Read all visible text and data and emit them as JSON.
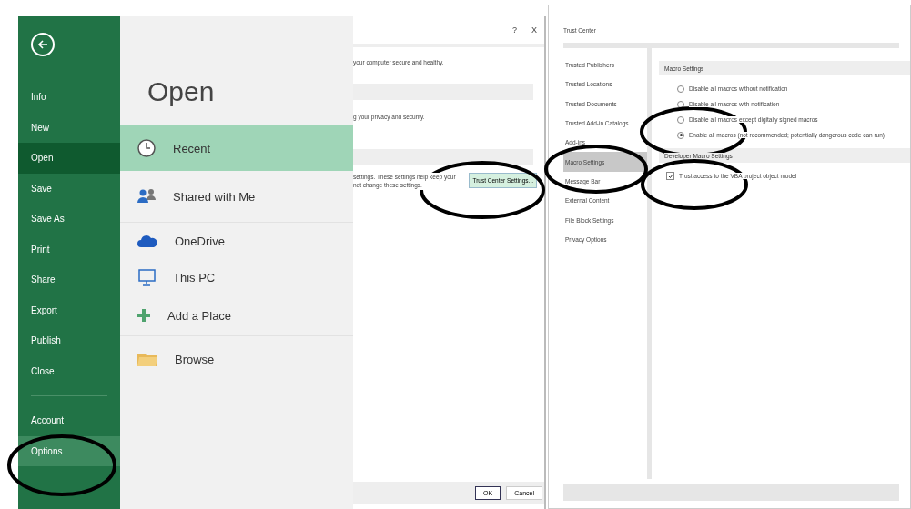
{
  "backstage": {
    "nav": [
      {
        "label": "Info",
        "selected": false,
        "hover": false
      },
      {
        "label": "New",
        "selected": false,
        "hover": false
      },
      {
        "label": "Open",
        "selected": true,
        "hover": false
      },
      {
        "label": "Save",
        "selected": false,
        "hover": false
      },
      {
        "label": "Save As",
        "selected": false,
        "hover": false
      },
      {
        "label": "Print",
        "selected": false,
        "hover": false
      },
      {
        "label": "Share",
        "selected": false,
        "hover": false
      },
      {
        "label": "Export",
        "selected": false,
        "hover": false
      },
      {
        "label": "Publish",
        "selected": false,
        "hover": false
      },
      {
        "label": "Close",
        "selected": false,
        "hover": false
      },
      {
        "label": "Account",
        "selected": false,
        "hover": false
      },
      {
        "label": "Options",
        "selected": false,
        "hover": true
      }
    ],
    "title": "Open",
    "places": [
      {
        "label": "Recent",
        "kind": "recent",
        "selected": true
      },
      {
        "label": "Shared with Me",
        "kind": "shared",
        "selected": false
      },
      {
        "label": "OneDrive",
        "kind": "cloud",
        "selected": false
      },
      {
        "label": "This PC",
        "kind": "pc",
        "selected": false
      },
      {
        "label": "Add a Place",
        "kind": "add",
        "selected": false
      },
      {
        "label": "Browse",
        "kind": "folder",
        "selected": false
      }
    ]
  },
  "options_dialog": {
    "title_buttons": [
      "?",
      "X"
    ],
    "texts": [
      "your computer secure and healthy.",
      "g your privacy and security."
    ],
    "trust_text": "settings. These settings help keep your\nnot change these settings.",
    "trust_button": "Trust Center Settings...",
    "buttons": [
      "OK",
      "Cancel"
    ]
  },
  "trust_center": {
    "title": "Trust Center",
    "nav": [
      {
        "label": "Trusted Publishers",
        "selected": false
      },
      {
        "label": "Trusted Locations",
        "selected": false
      },
      {
        "label": "Trusted Documents",
        "selected": false
      },
      {
        "label": "Trusted Add-in Catalogs",
        "selected": false
      },
      {
        "label": "Add-ins",
        "selected": false
      },
      {
        "label": "Macro Settings",
        "selected": true
      },
      {
        "label": "Message Bar",
        "selected": false
      },
      {
        "label": "External Content",
        "selected": false
      },
      {
        "label": "File Block Settings",
        "selected": false
      },
      {
        "label": "Privacy Options",
        "selected": false
      }
    ],
    "macro_header": "Macro Settings",
    "macro_options": [
      {
        "label": "Disable all macros without notification",
        "selected": false
      },
      {
        "label": "Disable all macros with notification",
        "selected": false
      },
      {
        "label": "Disable all macros except digitally signed macros",
        "selected": false
      },
      {
        "label": "Enable all macros (not recommended; potentially dangerous code can run)",
        "selected": true
      }
    ],
    "developer_header": "Developer Macro Settings",
    "vba_checkbox": {
      "label": "Trust access to the VBA project object model",
      "checked": true
    }
  }
}
